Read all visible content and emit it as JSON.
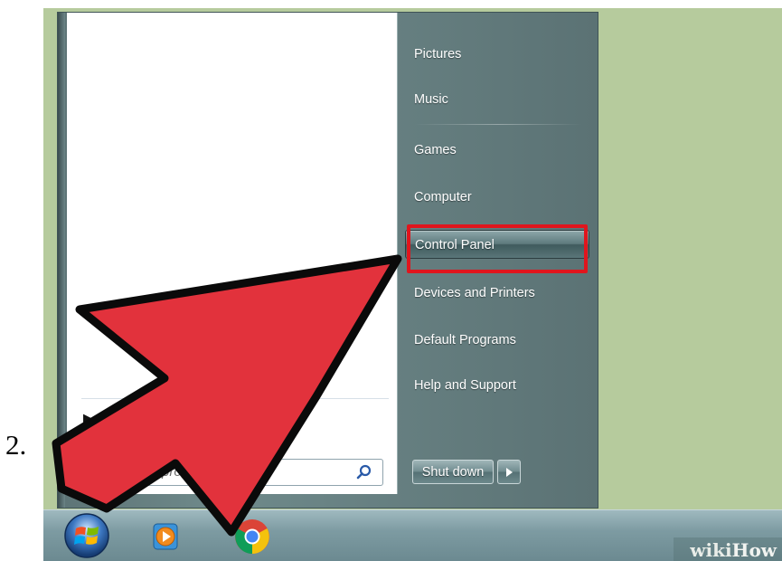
{
  "step_number": "2.",
  "start_menu": {
    "items": [
      {
        "label": "Pictures"
      },
      {
        "label": "Music"
      },
      {
        "label": "Games"
      },
      {
        "label": "Computer"
      },
      {
        "label": "Control Panel"
      },
      {
        "label": "Devices and Printers"
      },
      {
        "label": "Default Programs"
      },
      {
        "label": "Help and Support"
      }
    ],
    "highlighted_item": "Control Panel",
    "search": {
      "placeholder": "programs"
    },
    "shutdown_label": "Shut down"
  },
  "taskbar": {
    "icons": [
      "windows-start-orb",
      "media-player-icon",
      "chrome-icon"
    ]
  },
  "watermark": {
    "prefix": "wiki",
    "suffix": "How"
  },
  "colors": {
    "highlight_box": "#e0151d",
    "arrow_fill": "#e2323c",
    "background": "#b6cb9d"
  }
}
